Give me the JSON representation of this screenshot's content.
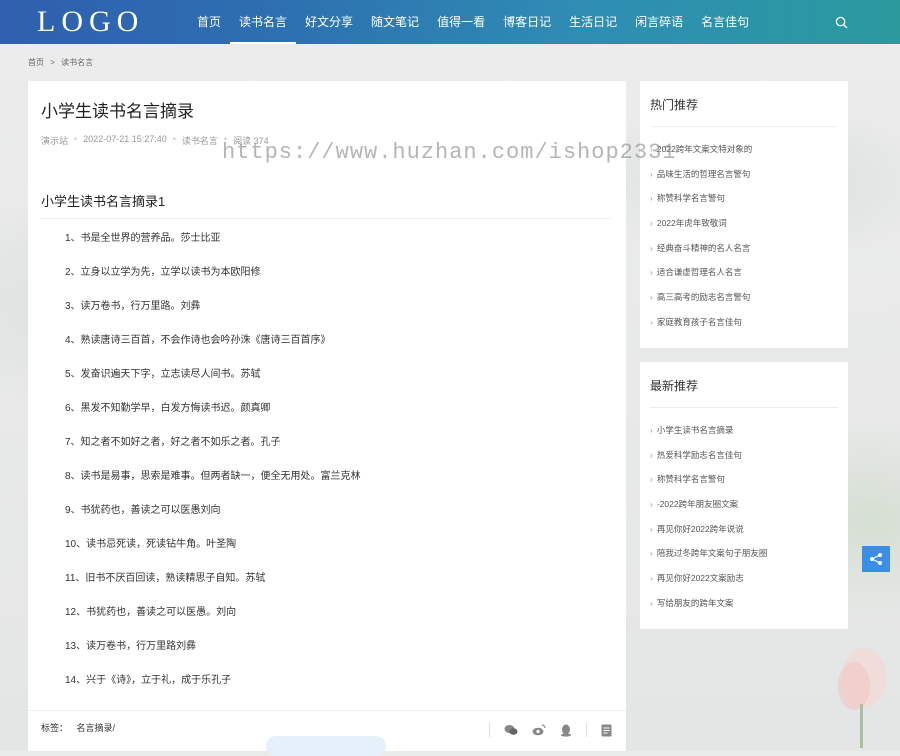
{
  "header": {
    "logo": "LOGO",
    "nav": [
      "首页",
      "读书名言",
      "好文分享",
      "随文笔记",
      "值得一看",
      "博客日记",
      "生活日记",
      "闲言碎语",
      "名言佳句"
    ],
    "active_index": 1,
    "search_icon": "search-icon"
  },
  "breadcrumb": {
    "home": "首页",
    "sep": ">",
    "current": "读书名言"
  },
  "article": {
    "title": "小学生读书名言摘录",
    "meta": {
      "author": "演示站",
      "date": "2022-07-21 15:27:40",
      "category": "读书名言",
      "views": "阅读 374"
    },
    "subtitle": "小学生读书名言摘录1",
    "quotes": [
      "1、书是全世界的营养品。莎士比亚",
      "2、立身以立学为先，立学以读书为本欧阳修",
      "3、读万卷书，行万里路。刘彝",
      "4、熟读唐诗三百首，不会作诗也会吟孙洙《唐诗三百首序》",
      "5、发奋识遍天下字，立志读尽人间书。苏轼",
      "6、黑发不知勤学早，白发方悔读书迟。颜真卿",
      "7、知之者不如好之者，好之者不如乐之者。孔子",
      "8、读书是易事，思索是难事。但两者缺一，便全无用处。富兰克林",
      "9、书犹药也，善读之可以医愚刘向",
      "10、读书忌死读，死读钻牛角。叶圣陶",
      "11、旧书不厌百回读，熟读精思子自知。苏轼",
      "12、书犹药也，善读之可以医愚。刘向",
      "13、读万卷书，行万里路刘彝",
      "14、兴于《诗》，立于礼，成于乐孔子"
    ],
    "tags_label": "标签：",
    "tags": [
      "名言摘录/"
    ]
  },
  "hot": {
    "title": "热门推荐",
    "items": [
      "2022跨年文案文特对象的",
      "品味生活的哲理名言警句",
      "称赞科学名言警句",
      "2022年虎年致敬词",
      "经典奋斗精神的名人名言",
      "适合谦虚哲理名人名言",
      "高三高考的励志名言警句",
      "家庭教育孩子名言佳句"
    ]
  },
  "latest": {
    "title": "最新推荐",
    "items": [
      "小学生读书名言摘录",
      "热爱科学励志名言佳句",
      "称赞科学名言警句",
      "-2022跨年朋友圈文案",
      "再见你好2022跨年说说",
      "陪我过冬跨年文案句子朋友圈",
      "再见你好2022文案励志",
      "写给朋友的跨年文案"
    ]
  },
  "watermark": "https://www.huzhan.com/ishop2331",
  "colors": {
    "header_start": "#2f5fae",
    "header_end": "#2a9a9d",
    "share_button": "#3a8ee6"
  }
}
